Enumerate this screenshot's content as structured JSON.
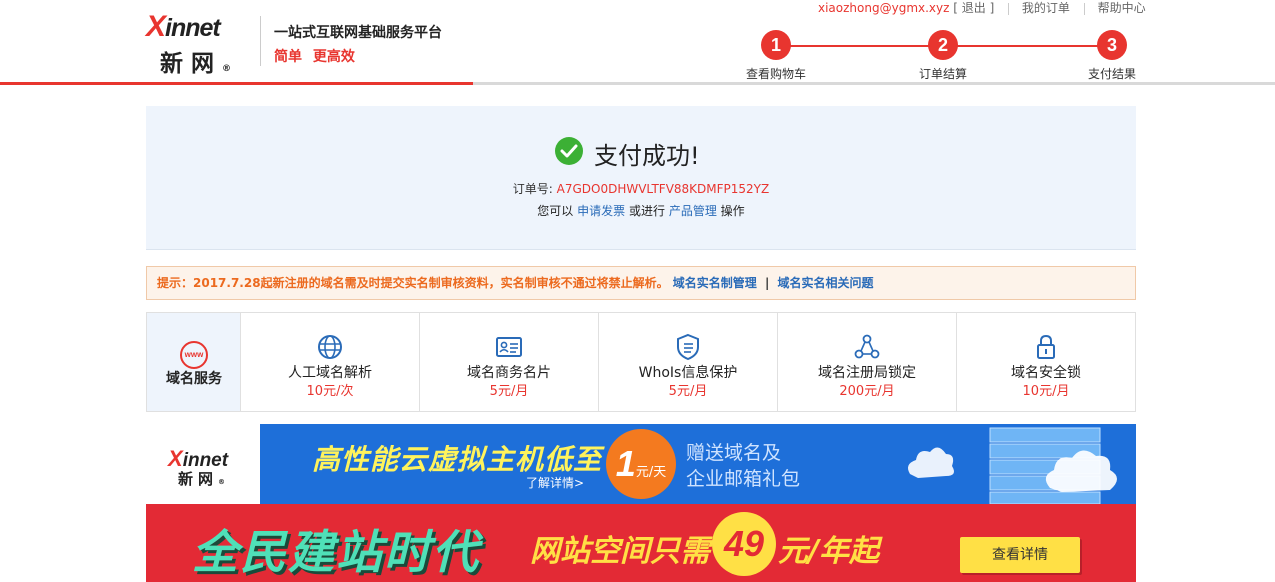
{
  "header": {
    "logo_en": "innet",
    "logo_en_x": "X",
    "logo_cn": "新网",
    "logo_reg": "®",
    "slogan": "一站式互联网基础服务平台",
    "tagline": "简单 更高效"
  },
  "toplinks": {
    "user": "xiaozhong@ygmx.xyz",
    "logout": "[ 退出 ]",
    "my_orders": "我的订单",
    "help": "帮助中心"
  },
  "steps": [
    {
      "num": "1",
      "label": "查看购物车"
    },
    {
      "num": "2",
      "label": "订单结算"
    },
    {
      "num": "3",
      "label": "支付结果"
    }
  ],
  "success": {
    "title": "支付成功!",
    "order_label": "订单号:",
    "order_id": "A7GDO0DHWVLTFV88KDMFP152YZ",
    "action_prefix": "您可以",
    "invoice_link": "申请发票",
    "action_mid": "或进行",
    "manage_link": "产品管理",
    "action_suffix": "操作"
  },
  "notice": {
    "text": "提示：2017.7.28起新注册的域名需及时提交实名制审核资料，实名制审核不通过将禁止解析。",
    "link1": "域名实名制管理",
    "divider": "|",
    "link2": "域名实名相关问题"
  },
  "services": {
    "heading_icon": "www",
    "heading": "域名服务",
    "items": [
      {
        "name": "人工域名解析",
        "price": "10元/次",
        "icon": "globe-icon"
      },
      {
        "name": "域名商务名片",
        "price": "5元/月",
        "icon": "id-card-icon"
      },
      {
        "name": "WhoIs信息保护",
        "price": "5元/月",
        "icon": "shield-icon"
      },
      {
        "name": "域名注册局锁定",
        "price": "200元/月",
        "icon": "network-icon"
      },
      {
        "name": "域名安全锁",
        "price": "10元/月",
        "icon": "lock-icon"
      }
    ]
  },
  "banner1": {
    "logo_en": "innet",
    "logo_en_x": "X",
    "logo_cn": "新网",
    "logo_reg": "®",
    "title": "高性能云虚拟主机低至",
    "more": "了解详情>",
    "price_big": "1",
    "price_unit": "元/天",
    "sub1": "赠送域名及",
    "sub2": "企业邮箱礼包"
  },
  "banner2": {
    "title": "全民建站时代",
    "sub_prefix": "网站空间只需",
    "price": "49",
    "sub_suffix": "元/年起",
    "button": "查看详情"
  },
  "colors": {
    "brand_red": "#e8352f",
    "success_green": "#3cb035",
    "link_blue": "#2a6bb8",
    "panel_bg": "#eef4fc"
  }
}
